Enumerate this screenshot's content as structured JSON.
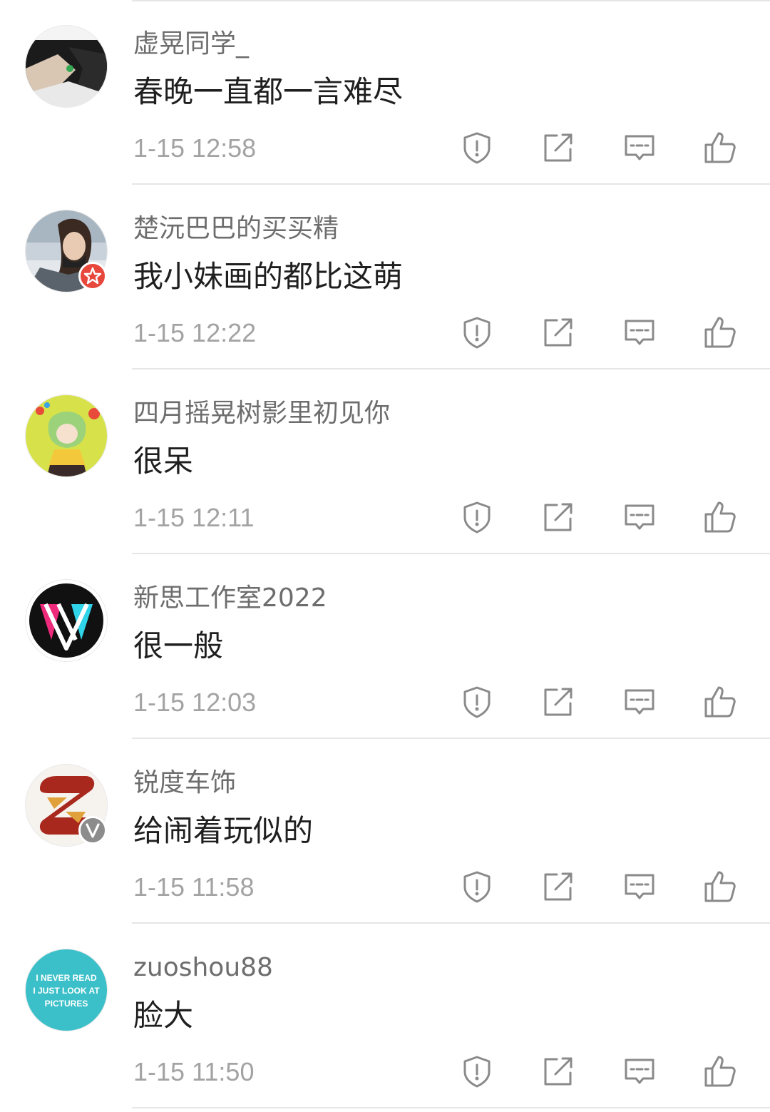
{
  "comments": [
    {
      "username": "虚晃同学_",
      "text": "春晚一直都一言难尽",
      "time": "1-15 12:58",
      "badge": ""
    },
    {
      "username": "楚沅巴巴的买买精",
      "text": "我小妹画的都比这萌",
      "time": "1-15 12:22",
      "badge": "star-badge"
    },
    {
      "username": "四月摇晃树影里初见你",
      "text": "很呆",
      "time": "1-15 12:11",
      "badge": ""
    },
    {
      "username": "新思工作室2022",
      "text": "很一般",
      "time": "1-15 12:03",
      "badge": ""
    },
    {
      "username": "锐度车饰",
      "text": "给闹着玩似的",
      "time": "1-15 11:58",
      "badge": "verified-badge"
    },
    {
      "username": "zuoshou88",
      "text": "脸大",
      "time": "1-15 11:50",
      "badge": ""
    }
  ],
  "avatar6_text": [
    "I NEVER READ",
    "I JUST LOOK AT",
    "PICTURES"
  ],
  "colors": {
    "icon": "#8a8a8a",
    "username": "#6d6d6d",
    "text": "#1f1f1f",
    "time": "#a3a3a3",
    "star_badge": "#e8473c",
    "verified_badge": "#8c8c8c"
  },
  "icons": [
    "report-icon",
    "share-icon",
    "reply-icon",
    "like-icon"
  ]
}
